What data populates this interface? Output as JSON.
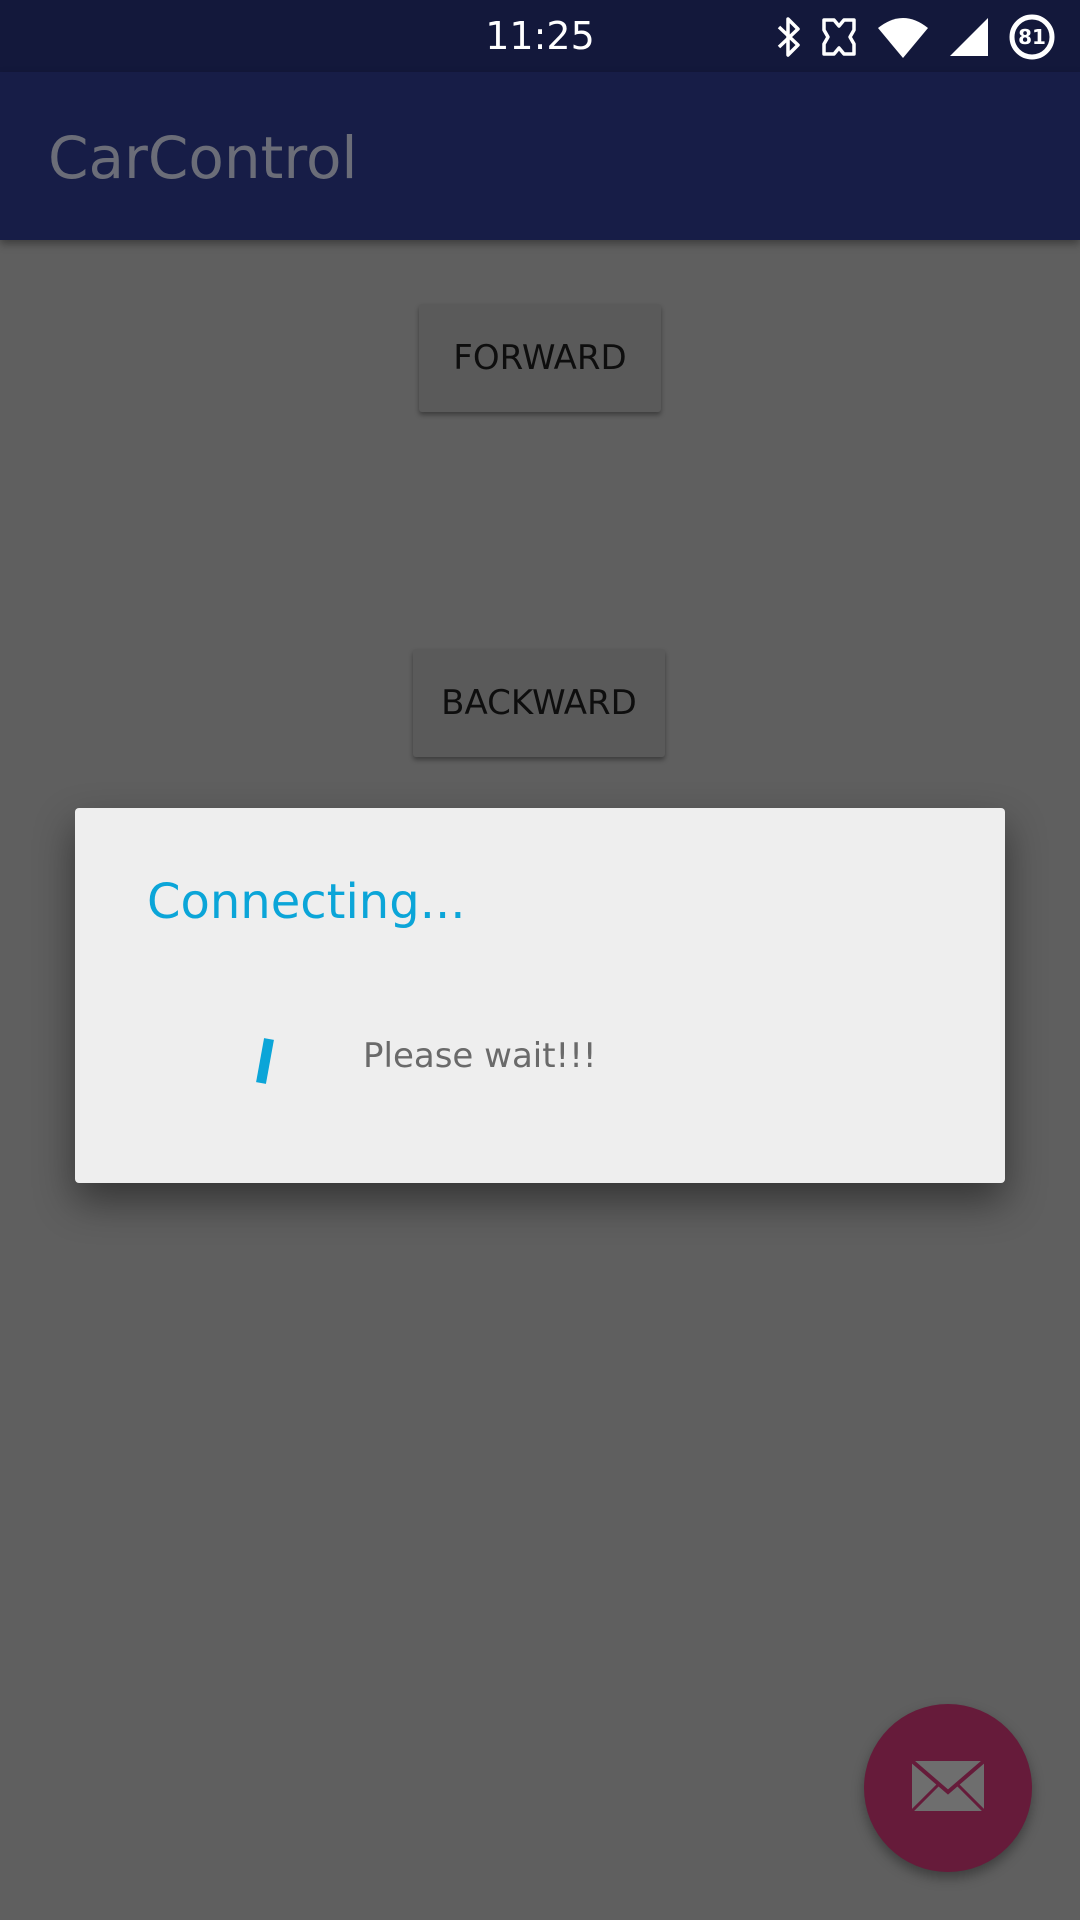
{
  "status_bar": {
    "time": "11:25",
    "battery_level": "81",
    "icons": [
      "bluetooth-icon",
      "nfc-icon",
      "wifi-icon",
      "signal-icon",
      "battery-icon"
    ]
  },
  "app_bar": {
    "title": "CarControl"
  },
  "controls": {
    "forward_label": "FORWARD",
    "backward_label": "BACKWARD"
  },
  "dialog": {
    "title": "Connecting...",
    "message": "Please wait!!!",
    "accent_color": "#0ba5d8"
  },
  "fab": {
    "icon": "mail-icon",
    "color": "#661b3a"
  }
}
